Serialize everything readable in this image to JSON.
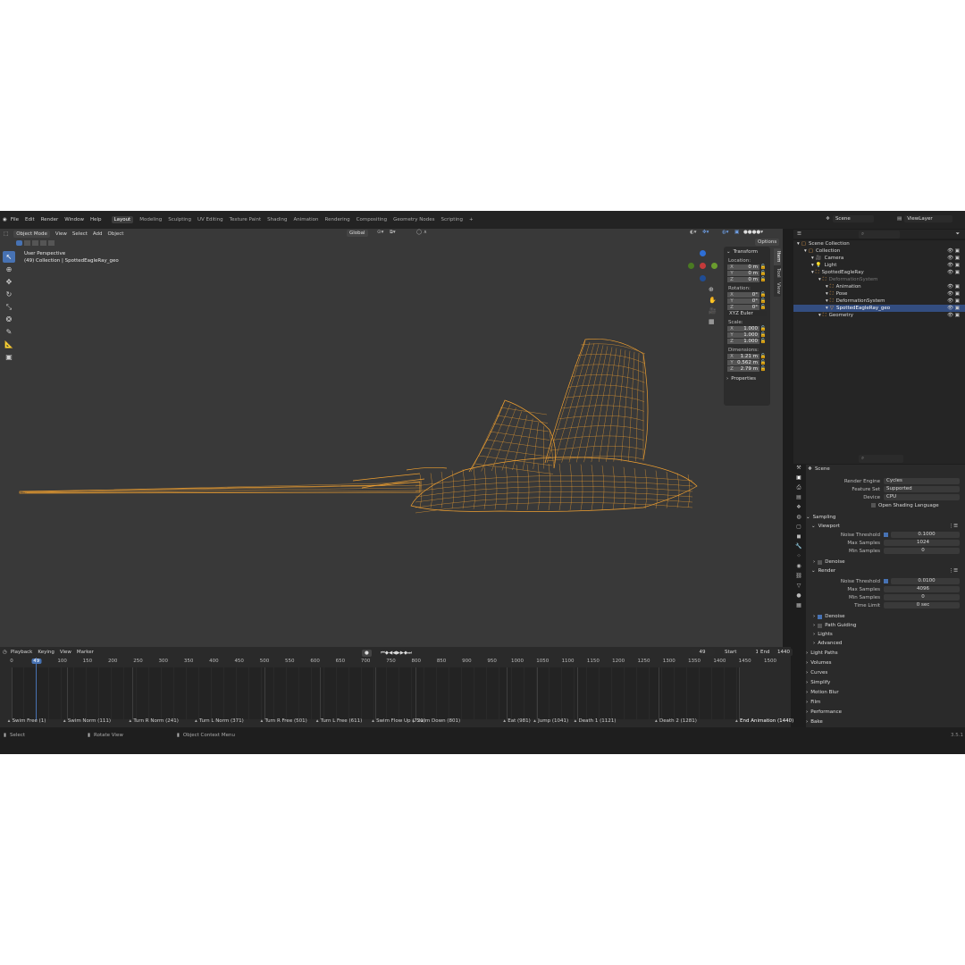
{
  "menu": [
    "File",
    "Edit",
    "Render",
    "Window",
    "Help"
  ],
  "workspaces": [
    "Layout",
    "Modeling",
    "Sculpting",
    "UV Editing",
    "Texture Paint",
    "Shading",
    "Animation",
    "Rendering",
    "Compositing",
    "Geometry Nodes",
    "Scripting",
    "+"
  ],
  "scene": {
    "label": "Scene",
    "view_layer": "ViewLayer"
  },
  "viewport": {
    "mode": "Object Mode",
    "menus": [
      "View",
      "Select",
      "Add",
      "Object"
    ],
    "transform_space": "Global",
    "options": "Options",
    "title": "User Perspective",
    "subtitle": "(49) Collection | SpottedEagleRay_geo",
    "wire_color": "#f0a030"
  },
  "npanel": {
    "tabs": [
      "Item",
      "Tool",
      "View"
    ],
    "transform": "Transform",
    "location_label": "Location:",
    "location": [
      {
        "ax": "X",
        "v": "0 m"
      },
      {
        "ax": "Y",
        "v": "0 m"
      },
      {
        "ax": "Z",
        "v": "0 m"
      }
    ],
    "rotation_label": "Rotation:",
    "rotation": [
      {
        "ax": "X",
        "v": "0°"
      },
      {
        "ax": "Y",
        "v": "0°"
      },
      {
        "ax": "Z",
        "v": "0°"
      }
    ],
    "rotation_mode": "XYZ Euler",
    "scale_label": "Scale:",
    "scale": [
      {
        "ax": "X",
        "v": "1.000"
      },
      {
        "ax": "Y",
        "v": "1.000"
      },
      {
        "ax": "Z",
        "v": "1.000"
      }
    ],
    "dimensions_label": "Dimensions:",
    "dimensions": [
      {
        "ax": "X",
        "v": "1.21 m"
      },
      {
        "ax": "Y",
        "v": "0.562 m"
      },
      {
        "ax": "Z",
        "v": "2.79 m"
      }
    ],
    "properties": "Properties"
  },
  "timeline": {
    "menus": [
      "Playback",
      "Keying",
      "View",
      "Marker"
    ],
    "current_frame": "49",
    "start_label": "Start",
    "start": "1",
    "end_label": "End",
    "end": "1440",
    "ruler": [
      "0",
      "49",
      "100",
      "150",
      "200",
      "250",
      "300",
      "350",
      "400",
      "450",
      "500",
      "550",
      "600",
      "650",
      "700",
      "750",
      "800",
      "850",
      "900",
      "950",
      "1000",
      "1050",
      "1100",
      "1150",
      "1200",
      "1250",
      "1300",
      "1350",
      "1400",
      "1450",
      "1500"
    ],
    "markers": [
      "Swim Free (1)",
      "Swim Norm (111)",
      "Turn R Norm (241)",
      "Turn L Norm (371)",
      "Turn R Free (501)",
      "Turn L Free (611)",
      "Swim Flow Up (721)",
      "Swim Down (801)",
      "Eat (981)",
      "Jump (1041)",
      "Death 1 (1121)",
      "Death 2 (1281)",
      "End Animation (1440)"
    ]
  },
  "outliner": {
    "rows": [
      {
        "label": "Scene Collection",
        "indent": 0
      },
      {
        "label": "Collection",
        "indent": 1
      },
      {
        "label": "Camera",
        "indent": 2
      },
      {
        "label": "Light",
        "indent": 2
      },
      {
        "label": "SpottedEagleRay",
        "indent": 2
      },
      {
        "label": "DeformationSystem",
        "indent": 3,
        "dim": true
      },
      {
        "label": "Animation",
        "indent": 4
      },
      {
        "label": "Pose",
        "indent": 4
      },
      {
        "label": "DeformationSystem",
        "indent": 4
      },
      {
        "label": "SpottedEagleRay_geo",
        "indent": 4,
        "selected": true
      },
      {
        "label": "Geometry",
        "indent": 3
      }
    ]
  },
  "properties": {
    "scene": "Scene",
    "render_engine_label": "Render Engine",
    "render_engine": "Cycles",
    "feature_set_label": "Feature Set",
    "feature_set": "Supported",
    "device_label": "Device",
    "device": "CPU",
    "osl": "Open Shading Language",
    "sampling": "Sampling",
    "viewport": "Viewport",
    "vp_noise_label": "Noise Threshold",
    "vp_noise": "0.1000",
    "vp_max_label": "Max Samples",
    "vp_max": "1024",
    "vp_min_label": "Min Samples",
    "vp_min": "0",
    "denoise": "Denoise",
    "render": "Render",
    "r_noise_label": "Noise Threshold",
    "r_noise": "0.0100",
    "r_max_label": "Max Samples",
    "r_max": "4096",
    "r_min_label": "Min Samples",
    "r_min": "0",
    "r_time_label": "Time Limit",
    "r_time": "0 sec",
    "r_denoise": "Denoise",
    "path_guiding": "Path Guiding",
    "lights": "Lights",
    "advanced": "Advanced",
    "sections": [
      "Light Paths",
      "Volumes",
      "Curves",
      "Simplify",
      "Motion Blur",
      "Film",
      "Performance",
      "Bake"
    ]
  },
  "status": {
    "select": "Select",
    "rotate": "Rotate View",
    "context": "Object Context Menu",
    "version": "3.5.1"
  }
}
